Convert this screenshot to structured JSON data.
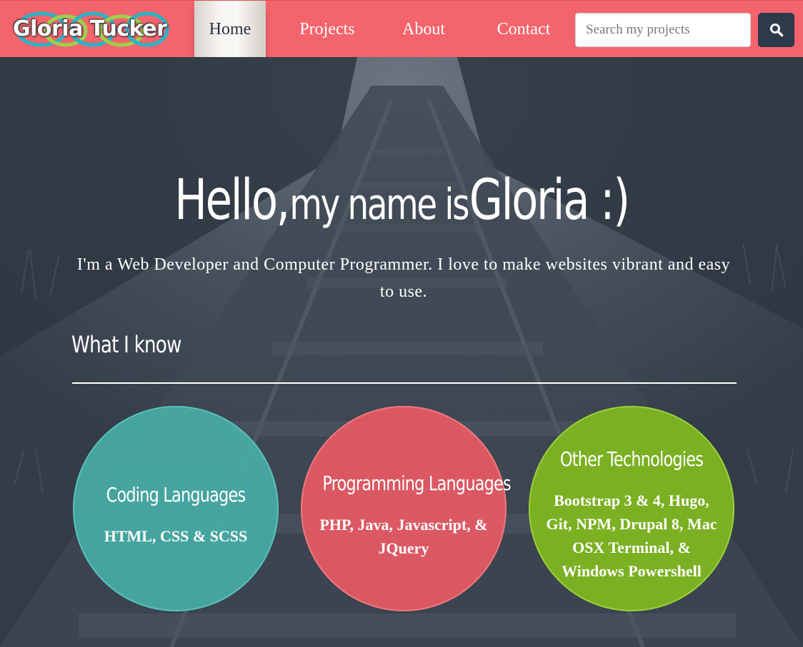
{
  "nav": {
    "logo_text": "Gloria Tucker",
    "items": [
      {
        "label": "Home",
        "active": true
      },
      {
        "label": "Projects",
        "active": false
      },
      {
        "label": "About",
        "active": false
      },
      {
        "label": "Contact",
        "active": false
      }
    ],
    "search": {
      "placeholder": "Search my projects",
      "value": "",
      "button_icon": "search-icon"
    }
  },
  "hero": {
    "greeting_part1": "Hello,",
    "greeting_part2": "my name is",
    "greeting_part3": "Gloria :)",
    "tagline": "I'm a Web Developer and Computer Programmer. I love to make websites vibrant and easy to use."
  },
  "skills": {
    "title": "What I know",
    "cards": [
      {
        "title": "Coding Languages",
        "body": "HTML, CSS & SCSS",
        "color": "#48aca6"
      },
      {
        "title": "Programming Languages",
        "body": "PHP, Java, Javascript, & JQuery",
        "color": "#e85a64"
      },
      {
        "title": "Other Technologies",
        "body": "Bootstrap 3 & 4, Hugo, Git, NPM, Drupal 8, Mac OSX Terminal, & Windows Powershell",
        "color": "#7eb620"
      }
    ]
  },
  "colors": {
    "navbar": "#f4646c",
    "search_button": "#2d3a4a",
    "hero_overlay": "#3a4350"
  }
}
